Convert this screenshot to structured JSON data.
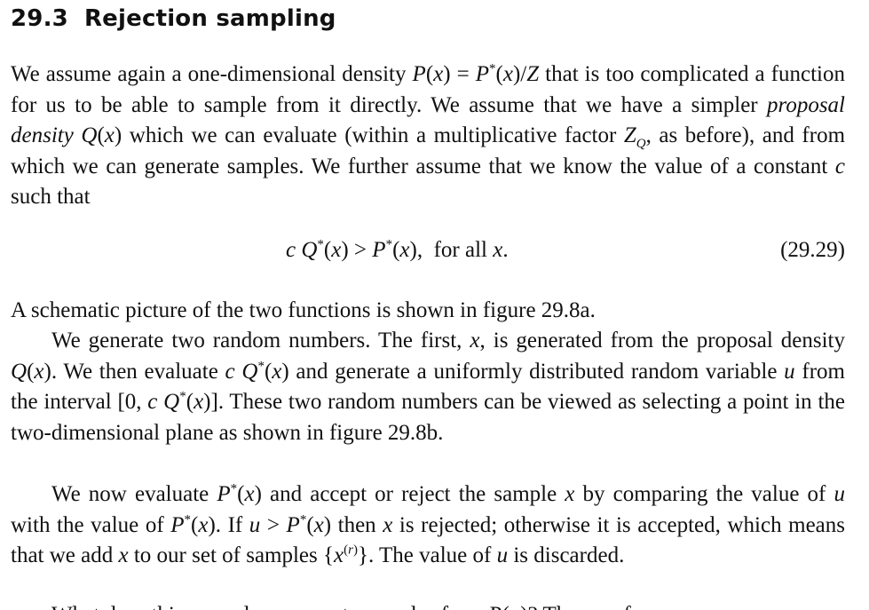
{
  "section": {
    "number": "29.3",
    "title": "Rejection sampling"
  },
  "paragraphs": [
    {
      "id": "p1",
      "text": "We assume again a one-dimensional density P(x) = P*(x)/Z that is too complicated a function for us to be able to sample from it directly. We assume that we have a simpler proposal density Q(x) which we can evaluate (within a multiplicative factor Z_Q, as before), and from which we can generate samples. We further assume that we know the value of a constant c such that"
    },
    {
      "id": "p2",
      "text": "A schematic picture of the two functions is shown in figure 29.8a."
    },
    {
      "id": "p3",
      "text": "We generate two random numbers. The first, x, is generated from the proposal density Q(x). We then evaluate c Q*(x) and generate a uniformly distributed random variable u from the interval [0, c Q*(x)]. These two random numbers can be viewed as selecting a point in the two-dimensional plane as shown in figure 29.8b."
    },
    {
      "id": "p4",
      "text": "We now evaluate P*(x) and accept or reject the sample x by comparing the value of u with the value of P*(x). If u > P*(x) then x is rejected; otherwise it is accepted, which means that we add x to our set of samples {x^(r)}. The value of u is discarded."
    }
  ],
  "equation": {
    "expression": "c Q*(x) > P*(x),  for all x.",
    "number": "(29.29)"
  },
  "cut_off_line": "What does this procedure generate samples from P(x)? The proof"
}
